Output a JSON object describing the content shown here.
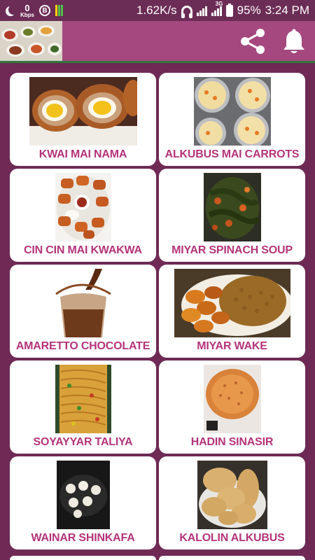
{
  "status_bar": {
    "speed_value": "0",
    "speed_unit": "Kbps",
    "b_badge": "B",
    "net_speed": "1.62K/s",
    "network_type": "3G",
    "battery": "95%",
    "time": "3:24 PM"
  },
  "app_bar": {
    "logo": "food-collage-logo",
    "share_icon": "share-icon",
    "bell_icon": "bell-icon"
  },
  "recipes": [
    {
      "label": "KWAI MAI NAMA",
      "image": "scotch-eggs"
    },
    {
      "label": "ALKUBUS MAI CARROTS",
      "image": "carrot-bread-pans"
    },
    {
      "label": "CIN CIN MAI KWAKWA",
      "image": "fried-chinchin-bowl"
    },
    {
      "label": "MIYAR SPINACH SOUP",
      "image": "spinach-soup"
    },
    {
      "label": "AMARETTO CHOCOLATE",
      "image": "chocolate-drink"
    },
    {
      "label": "MIYAR WAKE",
      "image": "beans-and-plantain"
    },
    {
      "label": "SOYAYYAR TALIYA",
      "image": "stir-fried-noodles"
    },
    {
      "label": "HADIN SINASIR",
      "image": "pancake"
    },
    {
      "label": "WAINAR SHINKAFA",
      "image": "masa-pan"
    },
    {
      "label": "KALOLIN ALKUBUS",
      "image": "steamed-bread-rolls"
    }
  ],
  "colors": {
    "background": "#6e2a55",
    "app_bar": "#a4487f",
    "label": "#b4347a",
    "card": "#ffffff"
  }
}
